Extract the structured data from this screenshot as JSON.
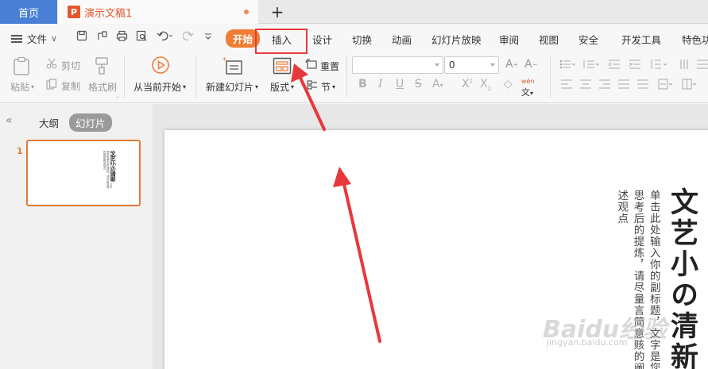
{
  "tabs": {
    "home": "首页",
    "document": "演示文稿1",
    "document_icon": "P",
    "add": "+"
  },
  "menu": {
    "file": "文件",
    "file_caret": "∨",
    "tabs": [
      "开始",
      "插入",
      "设计",
      "切换",
      "动画",
      "幻灯片放映",
      "审阅",
      "视图",
      "安全",
      "开发工具",
      "特色功"
    ],
    "active_tab": "开始"
  },
  "ribbon": {
    "paste": "粘贴",
    "cut": "剪切",
    "copy": "复制",
    "format_painter": "格式刷",
    "play_from_current": "从当前开始",
    "new_slide": "新建幻灯片",
    "layout": "版式",
    "reset": "重置",
    "section": "节",
    "font_size": "0"
  },
  "left_panel": {
    "outline_tab": "大纲",
    "slides_tab": "幻灯片",
    "slide_number": "1",
    "collapse": "«"
  },
  "slide": {
    "title": "文艺小の清新",
    "subtitle": "单击此处输入你的副标题，文字是您思考后的提炼，请尽量言简意赅的阐述观点"
  },
  "watermark": {
    "brand": "Baidu经验",
    "url": "jingyan.baidu.com"
  },
  "colors": {
    "accent": "#f07d35",
    "home_tab": "#4a7fd6",
    "annotation": "#e8383d"
  }
}
